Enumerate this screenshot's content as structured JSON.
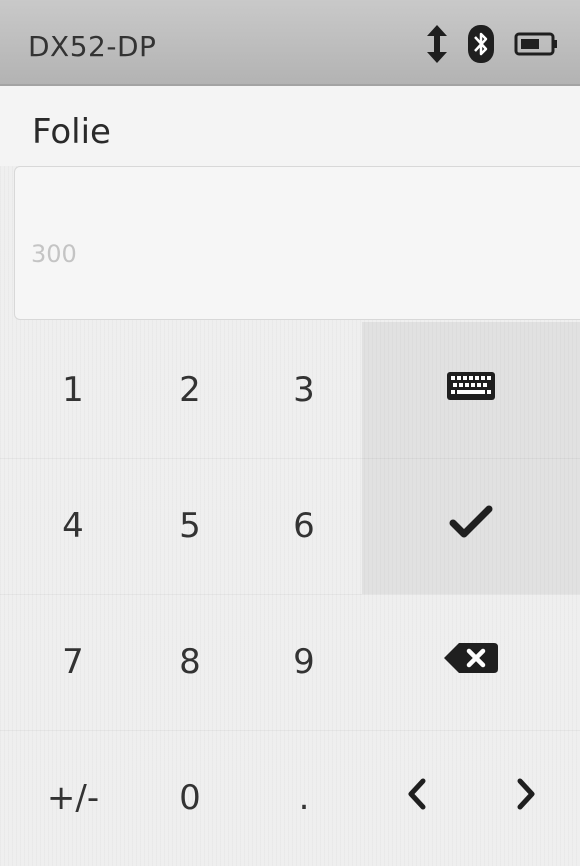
{
  "status_bar": {
    "device_name": "DX52-DP",
    "icons": [
      "connection-arrows-icon",
      "bluetooth-icon",
      "battery-icon"
    ]
  },
  "field": {
    "title": "Folie",
    "placeholder": "300"
  },
  "keypad": {
    "keys": {
      "k1": "1",
      "k2": "2",
      "k3": "3",
      "k4": "4",
      "k5": "5",
      "k6": "6",
      "k7": "7",
      "k8": "8",
      "k9": "9",
      "sign": "+/-",
      "k0": "0",
      "dot": "."
    },
    "function_keys": [
      "keyboard-icon",
      "confirm-check-icon",
      "backspace-icon",
      "cursor-left-icon",
      "cursor-right-icon"
    ]
  }
}
